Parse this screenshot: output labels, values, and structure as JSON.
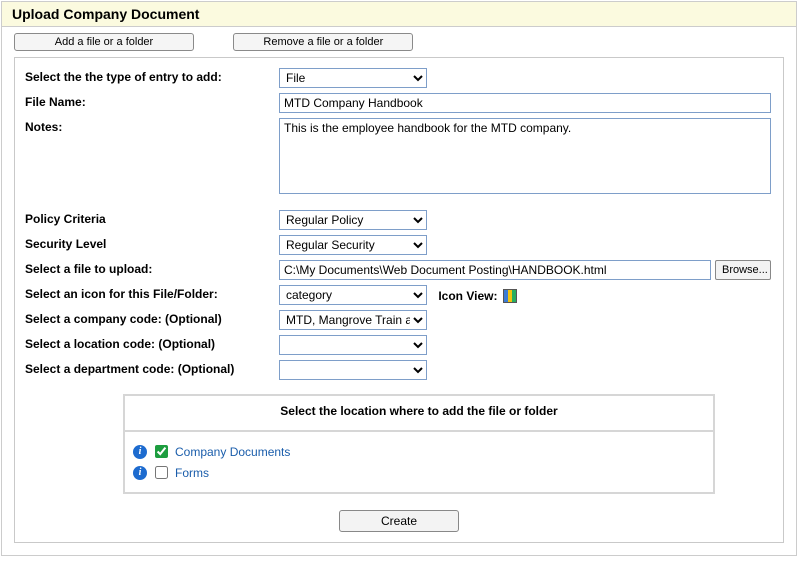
{
  "header": {
    "title": "Upload Company Document"
  },
  "top_buttons": {
    "add": "Add a file or a folder",
    "remove": "Remove a file or a folder"
  },
  "labels": {
    "entry_type": "Select the the type of entry to add:",
    "file_name": "File Name:",
    "notes": "Notes:",
    "policy": "Policy Criteria",
    "security": "Security Level",
    "file_upload": "Select a file to upload:",
    "icon": "Select an icon for this File/Folder:",
    "icon_view": "Icon View:",
    "company": "Select a company code: (Optional)",
    "location": "Select a location code: (Optional)",
    "department": "Select a department code: (Optional)",
    "loc_box_title": "Select the location where to add the file or folder"
  },
  "values": {
    "entry_type": "File",
    "file_name": "MTD Company Handbook",
    "notes": "This is the employee handbook for the MTD company.",
    "policy": "Regular Policy",
    "security": "Regular Security",
    "file_path": "C:\\My Documents\\Web Document Posting\\HANDBOOK.html",
    "icon": "category",
    "company": "MTD, Mangrove Train and De",
    "location": "",
    "department": ""
  },
  "buttons": {
    "browse": "Browse...",
    "create": "Create"
  },
  "tree": {
    "items": [
      {
        "label": "Company Documents",
        "checked": true
      },
      {
        "label": "Forms",
        "checked": false
      }
    ]
  }
}
